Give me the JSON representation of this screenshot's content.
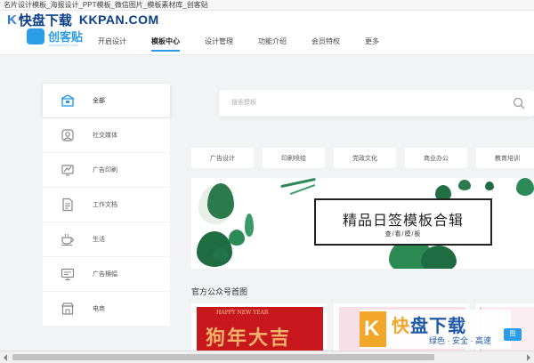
{
  "window": {
    "title": "名片设计模板_海报设计_PPT模板_微信图片_模板素材库_创客贴"
  },
  "watermark_top": {
    "brand": "快盘下载",
    "url": "KKPAN.COM"
  },
  "app": {
    "logo_text": "创客贴",
    "logo_sub": "CHUANGKIT.COM",
    "accent_color": "#2b9ce8"
  },
  "nav": {
    "items": [
      {
        "label": "开启设计"
      },
      {
        "label": "模板中心"
      },
      {
        "label": "设计管理"
      },
      {
        "label": "功能介绍"
      },
      {
        "label": "会员特权"
      },
      {
        "label": "更多"
      }
    ],
    "active": "模板中心"
  },
  "sidebar": {
    "items": [
      {
        "label": "全部",
        "icon": "box-icon"
      },
      {
        "label": "社交媒体",
        "icon": "social-icon"
      },
      {
        "label": "广告印刷",
        "icon": "print-icon"
      },
      {
        "label": "工作文档",
        "icon": "document-icon"
      },
      {
        "label": "生活",
        "icon": "cup-icon"
      },
      {
        "label": "广告横幅",
        "icon": "banner-icon"
      },
      {
        "label": "电商",
        "icon": "shop-icon"
      }
    ],
    "active": "全部"
  },
  "search": {
    "placeholder": "搜索模板"
  },
  "tags": [
    {
      "label": "广告设计"
    },
    {
      "label": "印刷喷绘"
    },
    {
      "label": "党政文化"
    },
    {
      "label": "商业办公"
    },
    {
      "label": "教育培训"
    }
  ],
  "banner": {
    "title": "精品日签模板合辑",
    "subtitle": "查/看/模/板"
  },
  "section": {
    "title": "官方公众号首图"
  },
  "cards": {
    "card1_small": "HAPPY NEW YEAR",
    "card1_big": "狗年大吉"
  },
  "watermark_bottom": {
    "brand_first": "快",
    "brand_rest": "盘下载",
    "slogan": "绿色 · 安全 · 高速",
    "badge": "图"
  }
}
